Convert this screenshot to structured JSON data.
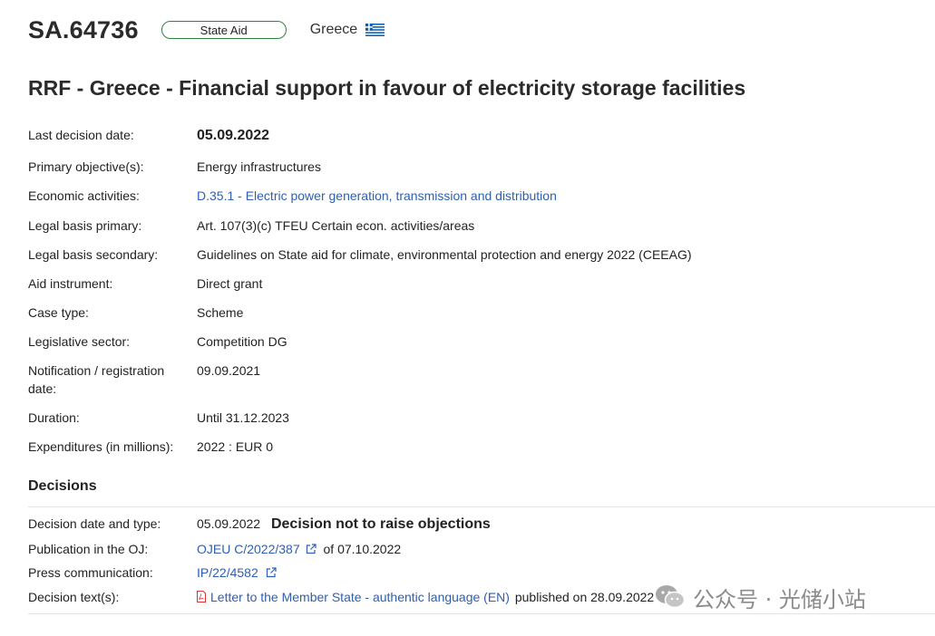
{
  "header": {
    "case_id": "SA.64736",
    "badge": "State Aid",
    "country": "Greece"
  },
  "title": "RRF - Greece - Financial support in favour of electricity storage facilities",
  "details": {
    "last_decision": {
      "label": "Last decision date:",
      "value": "05.09.2022"
    },
    "primary_objective": {
      "label": "Primary objective(s):",
      "value": "Energy infrastructures"
    },
    "economic_activities": {
      "label": "Economic activities:",
      "value": "D.35.1 - Electric power generation, transmission and distribution"
    },
    "legal_basis_primary": {
      "label": "Legal basis primary:",
      "value": "Art. 107(3)(c) TFEU Certain econ. activities/areas"
    },
    "legal_basis_secondary": {
      "label": "Legal basis secondary:",
      "value": "Guidelines on State aid for climate, environmental protection and energy 2022 (CEEAG)"
    },
    "aid_instrument": {
      "label": "Aid instrument:",
      "value": "Direct grant"
    },
    "case_type": {
      "label": "Case type:",
      "value": "Scheme"
    },
    "legislative_sector": {
      "label": "Legislative sector:",
      "value": "Competition DG"
    },
    "notification_date": {
      "label_line1": "Notification / registration",
      "label_line2": "date:",
      "value": "09.09.2021"
    },
    "duration": {
      "label": "Duration:",
      "value": "Until 31.12.2023"
    },
    "expenditures": {
      "label": "Expenditures (in millions):",
      "value": "2022 : EUR 0"
    }
  },
  "decisions": {
    "section_title": "Decisions",
    "decision": {
      "label": "Decision date and type:",
      "date": "05.09.2022",
      "type": "Decision not to raise objections"
    },
    "publication": {
      "label": "Publication in the OJ:",
      "link": "OJEU C/2022/387",
      "suffix": "of 07.10.2022"
    },
    "press": {
      "label": "Press communication:",
      "link": "IP/22/4582"
    },
    "text": {
      "label": "Decision text(s):",
      "link": "Letter to the Member State - authentic language (EN)",
      "suffix": "published on 28.09.2022"
    }
  },
  "watermark": {
    "text": "公众号 · 光储小站"
  },
  "colors": {
    "link": "#2f5fb0",
    "badge_border": "#2e8540",
    "flag_blue": "#0d5eaf"
  }
}
